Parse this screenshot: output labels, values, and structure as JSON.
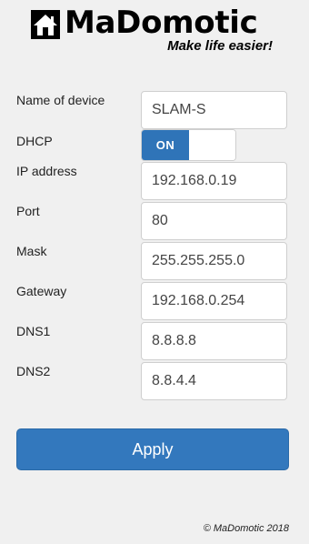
{
  "header": {
    "title": "MaDomotic",
    "tagline": "Make life easier!",
    "logo_icon": "house-icon"
  },
  "form": {
    "name_of_device": {
      "label": "Name of device",
      "value": "SLAM-S"
    },
    "dhcp": {
      "label": "DHCP",
      "state_label": "ON",
      "enabled": true
    },
    "ip_address": {
      "label": "IP address",
      "value": "192.168.0.19"
    },
    "port": {
      "label": "Port",
      "value": "80"
    },
    "mask": {
      "label": "Mask",
      "value": "255.255.255.0"
    },
    "gateway": {
      "label": "Gateway",
      "value": "192.168.0.254"
    },
    "dns1": {
      "label": "DNS1",
      "value": "8.8.8.8"
    },
    "dns2": {
      "label": "DNS2",
      "value": "8.8.4.4"
    }
  },
  "actions": {
    "apply_label": "Apply"
  },
  "footer": {
    "copyright": "© MaDomotic 2018"
  },
  "colors": {
    "accent": "#3378bd",
    "toggle_on": "#2f74b8",
    "background": "#f0f0f0"
  }
}
